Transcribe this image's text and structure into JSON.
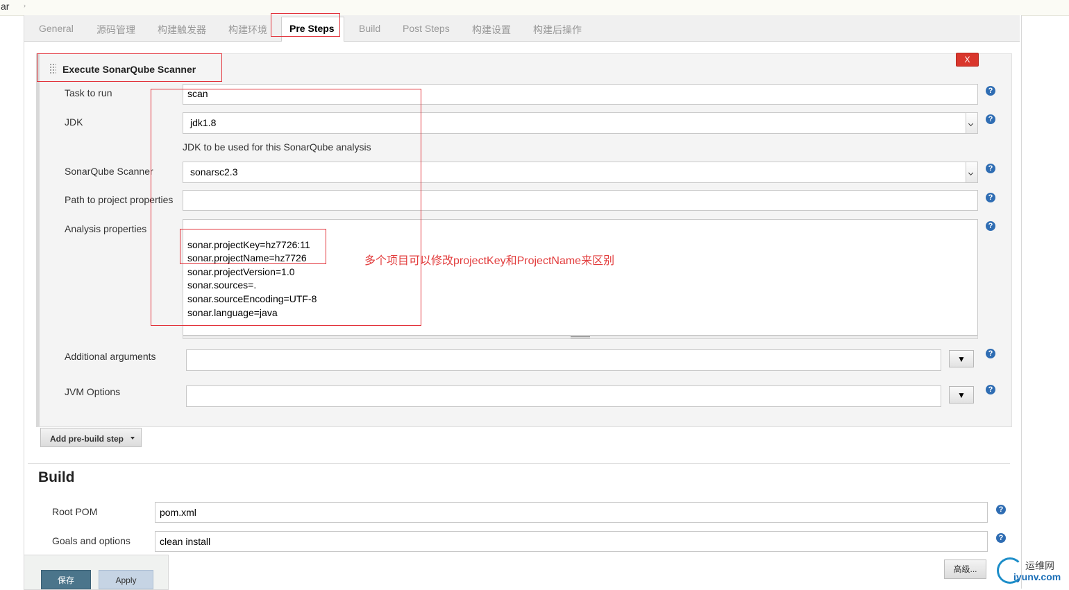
{
  "breadcrumb": {
    "text": "ar",
    "arrow": "›"
  },
  "tabs": [
    {
      "label": "General",
      "active": false
    },
    {
      "label": "源码管理",
      "active": false
    },
    {
      "label": "构建触发器",
      "active": false
    },
    {
      "label": "构建环境",
      "active": false
    },
    {
      "label": "Pre Steps",
      "active": true
    },
    {
      "label": "Build",
      "active": false
    },
    {
      "label": "Post Steps",
      "active": false
    },
    {
      "label": "构建设置",
      "active": false
    },
    {
      "label": "构建后操作",
      "active": false
    }
  ],
  "step": {
    "title": "Execute SonarQube Scanner",
    "delete_label": "X",
    "task_label": "Task to run",
    "task_value": "scan",
    "jdk_label": "JDK",
    "jdk_value": "jdk1.8",
    "jdk_help": "JDK to be used for this SonarQube analysis",
    "scanner_label": "SonarQube Scanner",
    "scanner_value": "sonarsc2.3",
    "path_label": "Path to project properties",
    "path_value": "",
    "analysis_label": "Analysis properties",
    "analysis_lines": [
      "sonar.projectKey=hz7726:11",
      "sonar.projectName=hz7726",
      "sonar.projectVersion=1.0",
      "sonar.sources=.",
      "sonar.sourceEncoding=UTF-8",
      "sonar.language=java"
    ],
    "additional_label": "Additional arguments",
    "additional_value": "",
    "jvm_label": "JVM Options",
    "jvm_value": "",
    "dropdown_glyph": "▼",
    "help_glyph": "?"
  },
  "annotation": "多个项目可以修改projectKey和ProjectName来区别",
  "add_step_label": "Add pre-build step",
  "build": {
    "heading": "Build",
    "root_pom_label": "Root POM",
    "root_pom_value": "pom.xml",
    "goals_label": "Goals and options",
    "goals_value": "clean install",
    "advanced_label": "高级..."
  },
  "footer": {
    "save_label": "保存",
    "apply_label": "Apply"
  },
  "watermark": {
    "top": "运维网",
    "bottom": "iyunv.com"
  },
  "colors": {
    "accent_red": "#e2323a",
    "save_bg": "#4b758b",
    "help_blue": "#2f6db3"
  }
}
